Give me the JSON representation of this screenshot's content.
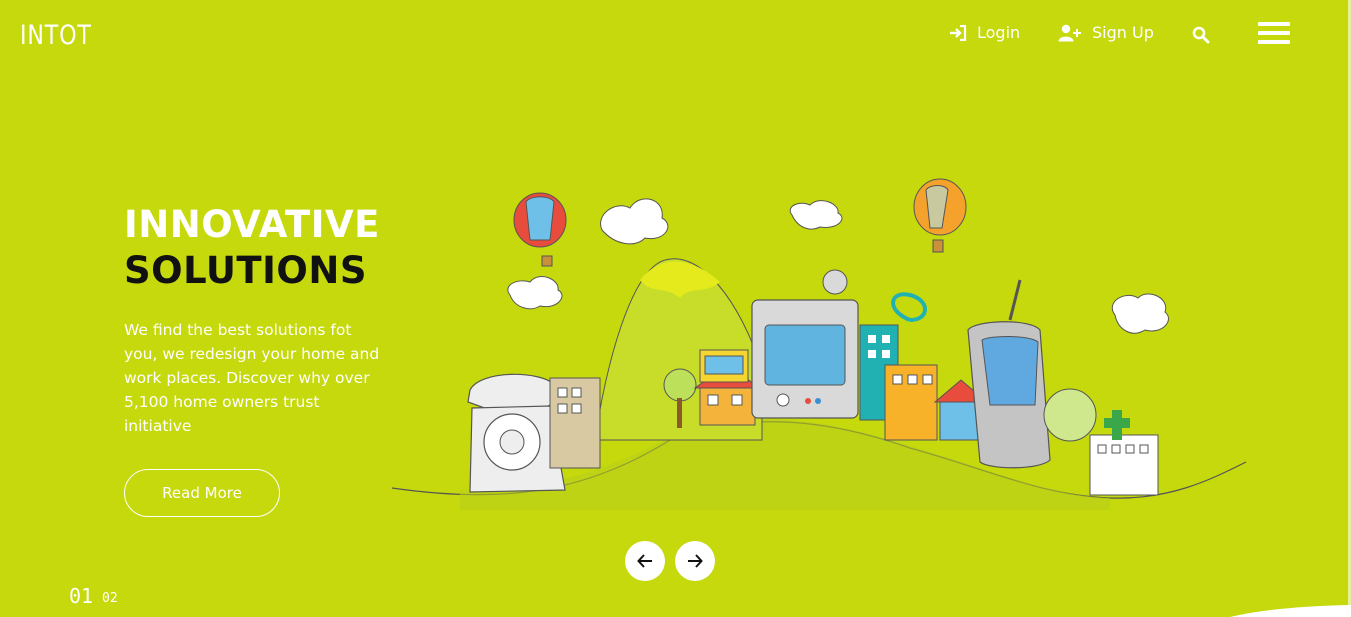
{
  "brand": {
    "logo": "INTOT"
  },
  "nav": {
    "login": "Login",
    "signup": "Sign Up"
  },
  "hero": {
    "title_line1": "INNOVATIVE",
    "title_line2": "SOLUTIONS",
    "text": "We find the best solutions fot you, we redesign your home and work places. Discover why over 5,100 home owners trust initiative",
    "cta": "Read More"
  },
  "slider": {
    "current": "01",
    "next": "02"
  },
  "icons": {
    "login": "sign-in-icon",
    "signup": "user-plus-icon",
    "search": "search-icon",
    "menu": "hamburger-menu-icon",
    "prev": "arrow-left-icon",
    "next": "arrow-right-icon"
  },
  "colors": {
    "background": "#c5d90d",
    "text_light": "#ffffff",
    "text_dark": "#111111"
  }
}
